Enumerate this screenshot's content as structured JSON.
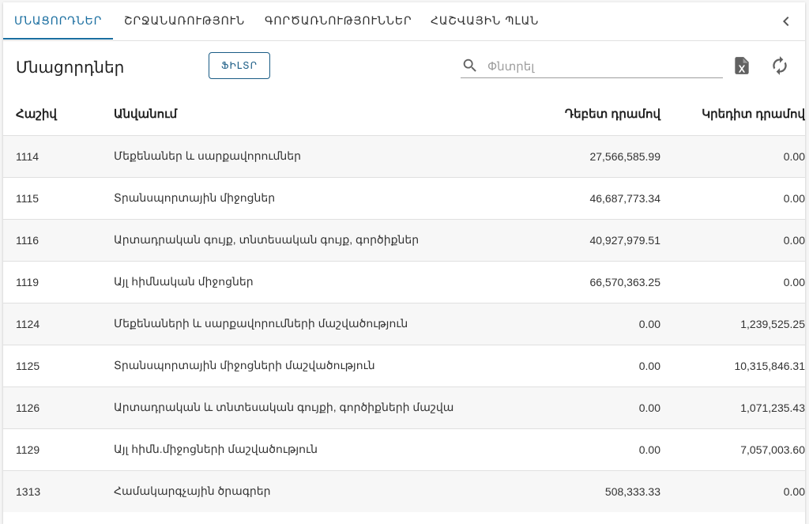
{
  "tabs": [
    {
      "label": "ՄՆԱՑՈՐԴՆԵՐ",
      "active": true
    },
    {
      "label": "ՇՐՋԱՆԱՌՈՒԹՅՈՒՆ",
      "active": false
    },
    {
      "label": "ԳՈՐԾԱՌՆՈՒԹՅՈՒՆՆԵՐ",
      "active": false
    },
    {
      "label": "ՀԱՇՎԱՅԻՆ ՊԼԱՆ",
      "active": false
    }
  ],
  "toolbar": {
    "title": "Մնացորդներ",
    "filter_label": "ՖԻԼՏՐ",
    "search_placeholder": "Փնտրել",
    "search_value": ""
  },
  "icons": {
    "collapse": "chevron-left-icon",
    "search": "search-icon",
    "export": "excel-file-icon",
    "refresh": "refresh-icon"
  },
  "colors": {
    "accent": "#1a6ea0",
    "filter_border": "#1a5c85",
    "row_alt": "#f7f7f7"
  },
  "table": {
    "headers": {
      "account": "Հաշիվ",
      "name": "Անվանում",
      "debit": "Դեբետ դրամով",
      "credit": "Կրեդիտ դրամով"
    },
    "rows": [
      {
        "account": "1114",
        "name": "Մեքենաներ և սարքավորումներ",
        "debit": "27,566,585.99",
        "credit": "0.00"
      },
      {
        "account": "1115",
        "name": "Տրանսպորտային միջոցներ",
        "debit": "46,687,773.34",
        "credit": "0.00"
      },
      {
        "account": "1116",
        "name": "Արտադրական գույք, տնտեսական գույք, գործիքներ",
        "debit": "40,927,979.51",
        "credit": "0.00"
      },
      {
        "account": "1119",
        "name": "Այլ հիմնական միջոցներ",
        "debit": "66,570,363.25",
        "credit": "0.00"
      },
      {
        "account": "1124",
        "name": "Մեքենաների և սարքավորումների մաշվածություն",
        "debit": "0.00",
        "credit": "1,239,525.25"
      },
      {
        "account": "1125",
        "name": "Տրանսպորտային միջոցների մաշվածություն",
        "debit": "0.00",
        "credit": "10,315,846.31"
      },
      {
        "account": "1126",
        "name": "Արտադրական և տնտեսական գույքի, գործիքների մաշված-ն",
        "debit": "0.00",
        "credit": "1,071,235.43"
      },
      {
        "account": "1129",
        "name": "Այլ հիմն.միջոցների մաշվածություն",
        "debit": "0.00",
        "credit": "7,057,003.60"
      },
      {
        "account": "1313",
        "name": "Համակարգչային ծրագրեր",
        "debit": "508,333.33",
        "credit": "0.00"
      }
    ]
  }
}
